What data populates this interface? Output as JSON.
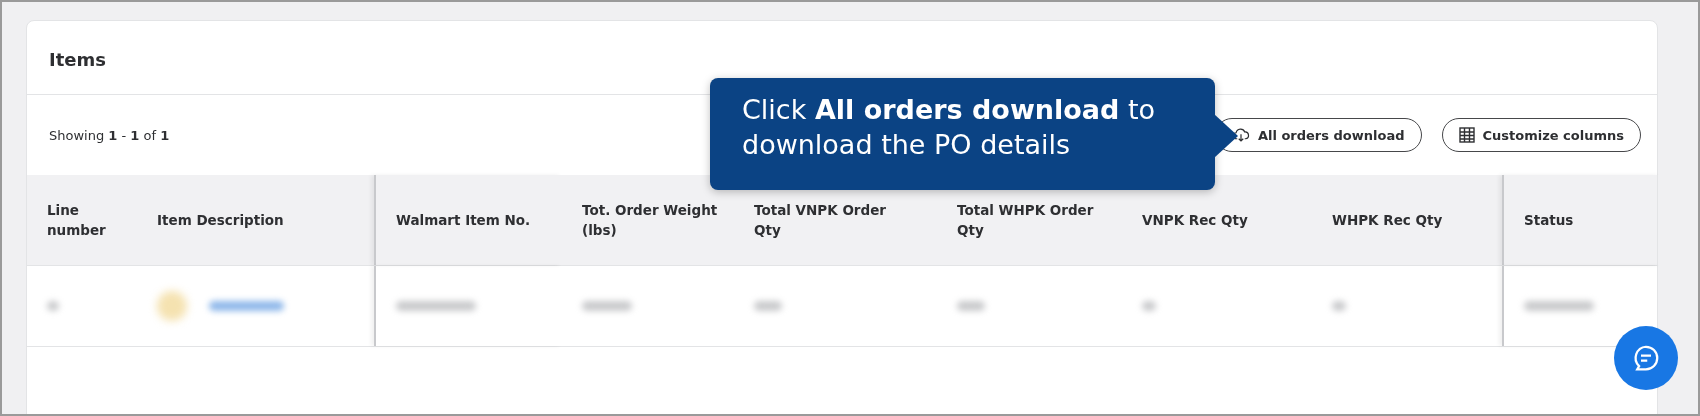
{
  "card": {
    "title": "Items"
  },
  "summary": "Showing **1** - **1** of **1**",
  "buttons": [
    {
      "kind": "download",
      "label": "All orders download"
    },
    {
      "kind": "columns",
      "label": "Customize columns"
    }
  ],
  "callout": {
    "text": "Click **All orders download** to download the PO details"
  },
  "table": {
    "columns": [
      "Line number",
      "Item Description",
      "Walmart Item No.",
      "Tot. Order Weight (lbs)",
      "Total VNPK Order Qty",
      "Total WHPK Order Qty",
      "VNPK Rec Qty",
      "WHPK Rec Qty",
      "Status"
    ],
    "rows": [
      {
        "cells": [
          {
            "kind": "blur"
          },
          {
            "kind": "thumb-link"
          },
          {
            "kind": "blur"
          },
          {
            "kind": "blur"
          },
          {
            "kind": "blur"
          },
          {
            "kind": "blur"
          },
          {
            "kind": "blur"
          },
          {
            "kind": "blur"
          },
          {
            "kind": "blur"
          }
        ]
      }
    ]
  },
  "chat_button": {
    "kind": "chat"
  }
}
